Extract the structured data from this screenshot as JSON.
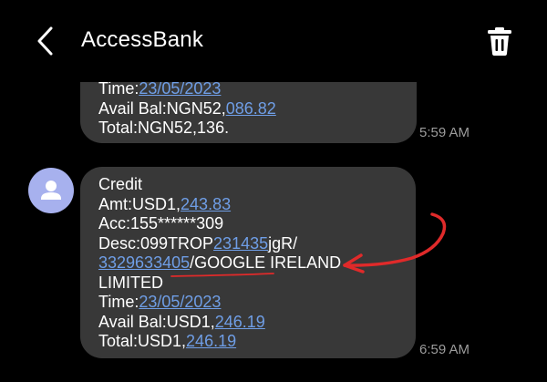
{
  "header": {
    "title": "AccessBank",
    "back_icon": "chevron-left-icon",
    "delete_icon": "trash-icon"
  },
  "messages": [
    {
      "lines": [
        {
          "parts": [
            {
              "text": "Time:"
            },
            {
              "text": "23/05/2023",
              "link": true
            }
          ]
        },
        {
          "parts": [
            {
              "text": "Avail Bal:NGN52,"
            },
            {
              "text": "086.82",
              "link": true
            }
          ]
        },
        {
          "parts": [
            {
              "text": "Total:NGN52,136."
            }
          ]
        }
      ],
      "time": "5:59 AM"
    },
    {
      "lines": [
        {
          "parts": [
            {
              "text": "Credit"
            }
          ]
        },
        {
          "parts": [
            {
              "text": "Amt:USD1,"
            },
            {
              "text": "243.83",
              "link": true
            }
          ]
        },
        {
          "parts": [
            {
              "text": "Acc:155******309"
            }
          ]
        },
        {
          "parts": [
            {
              "text": "Desc:099TROP"
            },
            {
              "text": "231435",
              "link": true
            },
            {
              "text": "jgR/"
            }
          ]
        },
        {
          "parts": [
            {
              "text": "3329633405",
              "link": true
            },
            {
              "text": "/GOOGLE IRELAND"
            }
          ]
        },
        {
          "parts": [
            {
              "text": "LIMITED"
            }
          ]
        },
        {
          "parts": [
            {
              "text": "Time:"
            },
            {
              "text": "23/05/2023",
              "link": true
            }
          ]
        },
        {
          "parts": [
            {
              "text": "Avail Bal:USD1,"
            },
            {
              "text": "246.19",
              "link": true
            }
          ]
        },
        {
          "parts": [
            {
              "text": "Total:USD1,"
            },
            {
              "text": "246.19",
              "link": true
            }
          ]
        }
      ],
      "time": "6:59 AM"
    }
  ],
  "colors": {
    "background": "#000000",
    "bubble": "#383838",
    "link": "#6f9ee6",
    "timestamp": "#9c9c9c",
    "avatar": "#a7b1ee",
    "annotation": "#e02a2a"
  }
}
